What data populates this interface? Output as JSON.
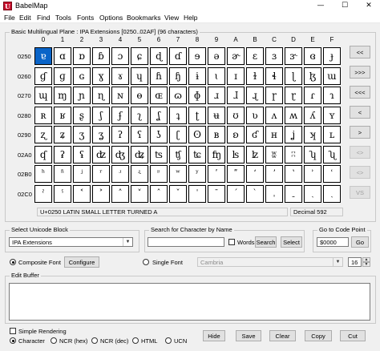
{
  "window": {
    "title": "BabelMap",
    "app_icon": "U",
    "minimize_glyph": "—",
    "maximize_glyph": "☐",
    "close_glyph": "✕"
  },
  "menu": [
    "File",
    "Edit",
    "Find",
    "Tools",
    "Fonts",
    "Options",
    "Bookmarks",
    "View",
    "Help"
  ],
  "grid": {
    "title": "Basic Multilingual Plane : IPA Extensions [0250..02AF] (96 characters)",
    "col_headers": [
      "0",
      "1",
      "2",
      "3",
      "4",
      "5",
      "6",
      "7",
      "8",
      "9",
      "A",
      "B",
      "C",
      "D",
      "E",
      "F"
    ],
    "row_headers": [
      "0250",
      "0260",
      "0270",
      "0280",
      "0290",
      "02A0",
      "02B0",
      "02C0"
    ],
    "rows": [
      [
        "ɐ",
        "ɑ",
        "ɒ",
        "ɓ",
        "ɔ",
        "ɕ",
        "ɖ",
        "ɗ",
        "ɘ",
        "ə",
        "ɚ",
        "ɛ",
        "ɜ",
        "ɝ",
        "ɞ",
        "ɟ"
      ],
      [
        "ɠ",
        "ɡ",
        "ɢ",
        "ɣ",
        "ɤ",
        "ɥ",
        "ɦ",
        "ɧ",
        "ɨ",
        "ɩ",
        "ɪ",
        "ɫ",
        "ɬ",
        "ɭ",
        "ɮ",
        "ɯ"
      ],
      [
        "ɰ",
        "ɱ",
        "ɲ",
        "ɳ",
        "ɴ",
        "ɵ",
        "ɶ",
        "ɷ",
        "ɸ",
        "ɹ",
        "ɺ",
        "ɻ",
        "ɼ",
        "ɽ",
        "ɾ",
        "ɿ"
      ],
      [
        "ʀ",
        "ʁ",
        "ʂ",
        "ʃ",
        "ʄ",
        "ʅ",
        "ʆ",
        "ʇ",
        "ʈ",
        "ʉ",
        "ʊ",
        "ʋ",
        "ʌ",
        "ʍ",
        "ʎ",
        "ʏ"
      ],
      [
        "ʐ",
        "ʑ",
        "ʒ",
        "ʓ",
        "ʔ",
        "ʕ",
        "ʖ",
        "ʗ",
        "ʘ",
        "ʙ",
        "ʚ",
        "ʛ",
        "ʜ",
        "ʝ",
        "ʞ",
        "ʟ"
      ],
      [
        "ʠ",
        "ʡ",
        "ʢ",
        "ʣ",
        "ʤ",
        "ʥ",
        "ʦ",
        "ʧ",
        "ʨ",
        "ʩ",
        "ʪ",
        "ʫ",
        "ʬ",
        "ʭ",
        "ʮ",
        "ʯ"
      ],
      [
        "ʰ",
        "ʱ",
        "ʲ",
        "ʳ",
        "ʴ",
        "ʵ",
        "ʶ",
        "ʷ",
        "ʸ",
        "ʹ",
        "ʺ",
        "ʻ",
        "ʼ",
        "ʽ",
        "ʾ",
        "ʿ"
      ],
      [
        "ˀ",
        "ˁ",
        "˂",
        "˃",
        "˄",
        "˅",
        "ˆ",
        "ˇ",
        "ˈ",
        "ˉ",
        "ˊ",
        "ˋ",
        "ˌ",
        "ˍ",
        "ˎ",
        "ˏ"
      ]
    ],
    "selected": "0250",
    "status_name": "U+0250 LATIN SMALL LETTER TURNED A",
    "status_decimal": "Decimal 592"
  },
  "nav_buttons": [
    {
      "label": "<<",
      "enabled": true
    },
    {
      "label": ">>>",
      "enabled": true
    },
    {
      "label": "<<<",
      "enabled": true
    },
    {
      "label": "<",
      "enabled": true
    },
    {
      "label": ">",
      "enabled": true
    },
    {
      "label": "<>",
      "enabled": false
    },
    {
      "label": "<>",
      "enabled": false
    },
    {
      "label": "VS",
      "enabled": false
    }
  ],
  "unicode_block": {
    "title": "Select Unicode Block",
    "value": "IPA Extensions"
  },
  "search": {
    "title": "Search for Character by Name",
    "value": "",
    "words_label": "Words",
    "search_button": "Search",
    "select_button": "Select"
  },
  "goto": {
    "title": "Go to Code Point",
    "value": "$0000",
    "go_button": "Go"
  },
  "font": {
    "composite_label": "Composite Font",
    "configure_button": "Configure",
    "single_label": "Single Font",
    "single_value": "Cambria",
    "size": "16"
  },
  "edit_buffer": {
    "title": "Edit Buffer",
    "value": ""
  },
  "bottom": {
    "simple_rendering": "Simple Rendering",
    "radios": [
      "Character",
      "NCR (hex)",
      "NCR (dec)",
      "HTML",
      "UCN"
    ],
    "selected_radio": "Character",
    "buttons": [
      "Hide",
      "Save",
      "Clear",
      "Copy",
      "Cut"
    ]
  },
  "icons": {
    "dropdown": "chevron-down-icon",
    "spinner_up": "triangle-up-icon",
    "spinner_down": "triangle-down-icon"
  }
}
